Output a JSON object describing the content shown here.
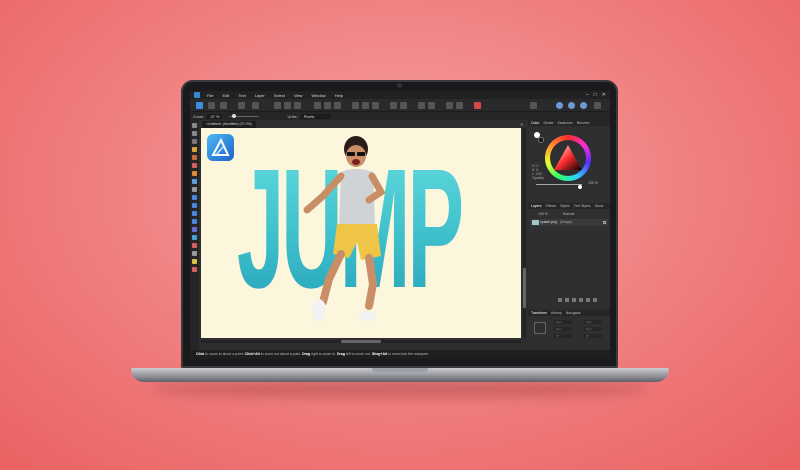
{
  "menu": {
    "items": [
      "File",
      "Edit",
      "Text",
      "Layer",
      "Select",
      "View",
      "Window",
      "Help"
    ],
    "controls": [
      "–",
      "□",
      "✕"
    ]
  },
  "context_toolbar": {
    "zoom_label": "Zoom:",
    "zoom_value": "37 %",
    "units_label": "Units:",
    "units_value": "Pixels"
  },
  "document": {
    "tab_title": "<Untitled> (Modified) (37.0%)",
    "close_glyph": "✕",
    "canvas_text": "JUMP",
    "background_color": "#fcf6dd",
    "text_gradient": [
      "#5ed7dc",
      "#2aa6bd"
    ]
  },
  "status_bar": {
    "k1": "Click",
    "t1": " to zoom in about a point. ",
    "k2": "Click+Alt",
    "t2": " to zoom out about a point. ",
    "k3": "Drag",
    "t3": " right to zoom in. ",
    "k4": "Drag",
    "t4": " left to zoom out. ",
    "k5": "Shag+Alt",
    "t5": " to zoom into the marquee."
  },
  "color_panel": {
    "tabs": [
      "Color",
      "Stroke",
      "Swatches",
      "Brushes"
    ],
    "hsl": [
      "H: 0",
      "S: 0",
      "L: 100"
    ],
    "opacity_label": "Opacity",
    "opacity_value": "100 %",
    "opacity_level": 1.0
  },
  "layers_panel": {
    "tabs": [
      "Layers",
      "Effects",
      "Styles",
      "Text Styles",
      "Stock"
    ],
    "opacity_value": "100 %",
    "blend_mode": "Normal",
    "layer_name": "splash.png",
    "layer_kind": "(Image)"
  },
  "transform_panel": {
    "tabs": [
      "Transform",
      "History",
      "Navigator"
    ],
    "fields": [
      "0 px",
      "0 px",
      "0 px",
      "0 px",
      "0°",
      "0°"
    ]
  },
  "colors": {
    "background": "#f07e7e",
    "accent": "#3b8ee0"
  }
}
